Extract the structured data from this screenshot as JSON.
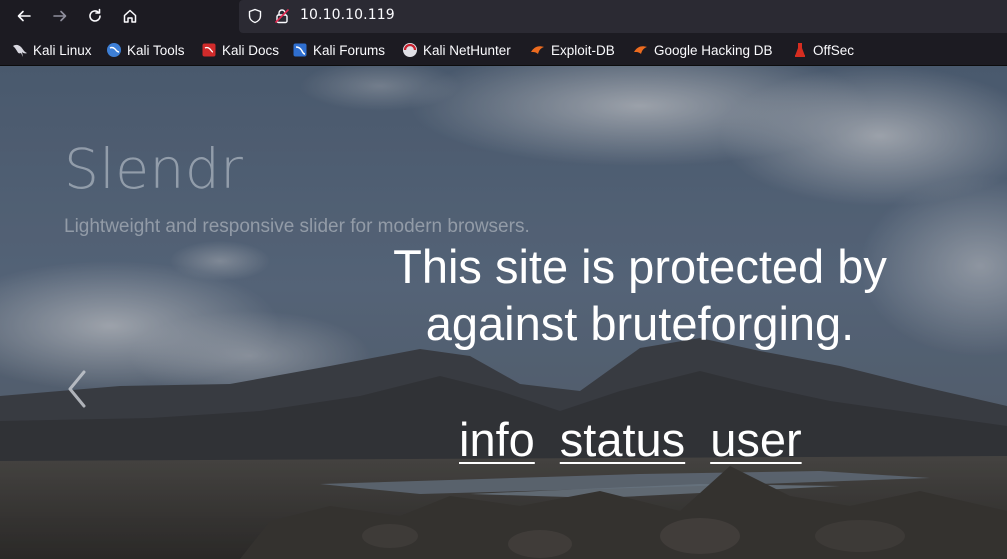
{
  "browser": {
    "url": "10.10.10.119",
    "bookmarks": [
      {
        "label": "Kali Linux",
        "icon": "kali-dragon-icon"
      },
      {
        "label": "Kali Tools",
        "icon": "kali-tools-icon"
      },
      {
        "label": "Kali Docs",
        "icon": "kali-docs-icon"
      },
      {
        "label": "Kali Forums",
        "icon": "kali-forums-icon"
      },
      {
        "label": "Kali NetHunter",
        "icon": "kali-nethunter-icon"
      },
      {
        "label": "Exploit-DB",
        "icon": "exploit-db-icon"
      },
      {
        "label": "Google Hacking DB",
        "icon": "ghdb-icon"
      },
      {
        "label": "OffSec",
        "icon": "offsec-icon"
      }
    ]
  },
  "slider": {
    "title": "Slendr",
    "subtitle": "Lightweight and responsive slider for modern browsers."
  },
  "notice": {
    "line1": "This site is protected by",
    "line2": "against bruteforging."
  },
  "links": {
    "info": "info",
    "status": "status",
    "user": "user"
  },
  "colors": {
    "chrome_bg": "#1c1b22",
    "urlbar_bg": "#2b2a33",
    "text": "#fbfbfe"
  }
}
